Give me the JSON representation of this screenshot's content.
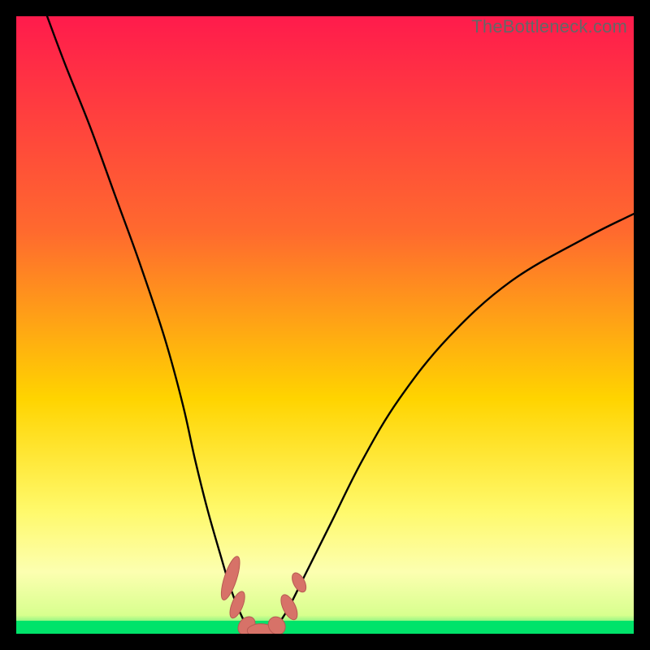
{
  "watermark": "TheBottleneck.com",
  "colors": {
    "bg": "#000000",
    "grad_top": "#ff1b4c",
    "grad_mid1": "#ff6a2e",
    "grad_mid2": "#ffd400",
    "grad_low": "#fff96a",
    "grad_band_light": "#fcffb0",
    "grad_band_green": "#00e36a",
    "curve": "#000000",
    "marker_fill": "#d77268",
    "marker_stroke": "#b85a52"
  },
  "chart_data": {
    "type": "line",
    "title": "",
    "xlabel": "",
    "ylabel": "",
    "xlim": [
      0,
      100
    ],
    "ylim": [
      0,
      100
    ],
    "series": [
      {
        "name": "left-curve",
        "x": [
          5,
          8,
          12,
          16,
          20,
          24,
          27,
          29,
          31,
          33,
          34.5,
          36,
          37.5
        ],
        "y": [
          100,
          92,
          82,
          71,
          60,
          48,
          37,
          28,
          20,
          13,
          8,
          4,
          1
        ]
      },
      {
        "name": "right-curve",
        "x": [
          42,
          44,
          47,
          51,
          56,
          62,
          70,
          80,
          92,
          100
        ],
        "y": [
          1,
          4,
          10,
          18,
          28,
          38,
          48,
          57,
          64,
          68
        ]
      },
      {
        "name": "valley-floor",
        "x": [
          37.5,
          38.5,
          40,
          41,
          42
        ],
        "y": [
          1,
          0.3,
          0.2,
          0.3,
          1
        ]
      }
    ],
    "markers": [
      {
        "shape": "blob",
        "cx": 34.7,
        "cy": 9.0,
        "rx": 1.0,
        "ry": 3.7,
        "rot": 18
      },
      {
        "shape": "blob",
        "cx": 35.8,
        "cy": 4.7,
        "rx": 0.9,
        "ry": 2.3,
        "rot": 22
      },
      {
        "shape": "blob",
        "cx": 37.3,
        "cy": 1.3,
        "rx": 1.2,
        "ry": 1.6,
        "rot": 40
      },
      {
        "shape": "blob",
        "cx": 39.6,
        "cy": 0.5,
        "rx": 2.2,
        "ry": 1.1,
        "rot": 0
      },
      {
        "shape": "blob",
        "cx": 42.2,
        "cy": 1.3,
        "rx": 1.3,
        "ry": 1.5,
        "rot": -35
      },
      {
        "shape": "blob",
        "cx": 44.2,
        "cy": 4.3,
        "rx": 1.0,
        "ry": 2.2,
        "rot": -26
      },
      {
        "shape": "blob",
        "cx": 45.8,
        "cy": 8.3,
        "rx": 0.9,
        "ry": 1.7,
        "rot": -28
      }
    ]
  }
}
